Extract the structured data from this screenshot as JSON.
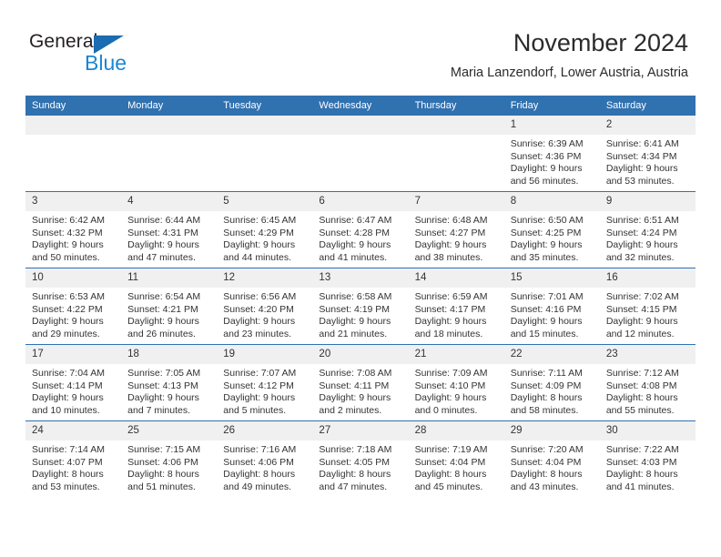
{
  "brand": {
    "name_part1": "General",
    "name_part2": "Blue",
    "logo_icon": "blue-triangle-logo",
    "accent_color": "#1b6cb0",
    "secondary_color": "#1b86d4"
  },
  "header": {
    "month_title": "November 2024",
    "location": "Maria Lanzendorf, Lower Austria, Austria"
  },
  "theme": {
    "header_row_color": "#3071b0",
    "daynum_strip_color": "#f0f0f0",
    "row_divider_color": "#3071b0",
    "text_color": "#333333"
  },
  "calendar": {
    "weekday_headers": [
      "Sunday",
      "Monday",
      "Tuesday",
      "Wednesday",
      "Thursday",
      "Friday",
      "Saturday"
    ],
    "weeks": [
      [
        {
          "day": "",
          "empty": true
        },
        {
          "day": "",
          "empty": true
        },
        {
          "day": "",
          "empty": true
        },
        {
          "day": "",
          "empty": true
        },
        {
          "day": "",
          "empty": true
        },
        {
          "day": "1",
          "sunrise": "Sunrise: 6:39 AM",
          "sunset": "Sunset: 4:36 PM",
          "daylight_line1": "Daylight: 9 hours",
          "daylight_line2": "and 56 minutes."
        },
        {
          "day": "2",
          "sunrise": "Sunrise: 6:41 AM",
          "sunset": "Sunset: 4:34 PM",
          "daylight_line1": "Daylight: 9 hours",
          "daylight_line2": "and 53 minutes."
        }
      ],
      [
        {
          "day": "3",
          "sunrise": "Sunrise: 6:42 AM",
          "sunset": "Sunset: 4:32 PM",
          "daylight_line1": "Daylight: 9 hours",
          "daylight_line2": "and 50 minutes."
        },
        {
          "day": "4",
          "sunrise": "Sunrise: 6:44 AM",
          "sunset": "Sunset: 4:31 PM",
          "daylight_line1": "Daylight: 9 hours",
          "daylight_line2": "and 47 minutes."
        },
        {
          "day": "5",
          "sunrise": "Sunrise: 6:45 AM",
          "sunset": "Sunset: 4:29 PM",
          "daylight_line1": "Daylight: 9 hours",
          "daylight_line2": "and 44 minutes."
        },
        {
          "day": "6",
          "sunrise": "Sunrise: 6:47 AM",
          "sunset": "Sunset: 4:28 PM",
          "daylight_line1": "Daylight: 9 hours",
          "daylight_line2": "and 41 minutes."
        },
        {
          "day": "7",
          "sunrise": "Sunrise: 6:48 AM",
          "sunset": "Sunset: 4:27 PM",
          "daylight_line1": "Daylight: 9 hours",
          "daylight_line2": "and 38 minutes."
        },
        {
          "day": "8",
          "sunrise": "Sunrise: 6:50 AM",
          "sunset": "Sunset: 4:25 PM",
          "daylight_line1": "Daylight: 9 hours",
          "daylight_line2": "and 35 minutes."
        },
        {
          "day": "9",
          "sunrise": "Sunrise: 6:51 AM",
          "sunset": "Sunset: 4:24 PM",
          "daylight_line1": "Daylight: 9 hours",
          "daylight_line2": "and 32 minutes."
        }
      ],
      [
        {
          "day": "10",
          "sunrise": "Sunrise: 6:53 AM",
          "sunset": "Sunset: 4:22 PM",
          "daylight_line1": "Daylight: 9 hours",
          "daylight_line2": "and 29 minutes."
        },
        {
          "day": "11",
          "sunrise": "Sunrise: 6:54 AM",
          "sunset": "Sunset: 4:21 PM",
          "daylight_line1": "Daylight: 9 hours",
          "daylight_line2": "and 26 minutes."
        },
        {
          "day": "12",
          "sunrise": "Sunrise: 6:56 AM",
          "sunset": "Sunset: 4:20 PM",
          "daylight_line1": "Daylight: 9 hours",
          "daylight_line2": "and 23 minutes."
        },
        {
          "day": "13",
          "sunrise": "Sunrise: 6:58 AM",
          "sunset": "Sunset: 4:19 PM",
          "daylight_line1": "Daylight: 9 hours",
          "daylight_line2": "and 21 minutes."
        },
        {
          "day": "14",
          "sunrise": "Sunrise: 6:59 AM",
          "sunset": "Sunset: 4:17 PM",
          "daylight_line1": "Daylight: 9 hours",
          "daylight_line2": "and 18 minutes."
        },
        {
          "day": "15",
          "sunrise": "Sunrise: 7:01 AM",
          "sunset": "Sunset: 4:16 PM",
          "daylight_line1": "Daylight: 9 hours",
          "daylight_line2": "and 15 minutes."
        },
        {
          "day": "16",
          "sunrise": "Sunrise: 7:02 AM",
          "sunset": "Sunset: 4:15 PM",
          "daylight_line1": "Daylight: 9 hours",
          "daylight_line2": "and 12 minutes."
        }
      ],
      [
        {
          "day": "17",
          "sunrise": "Sunrise: 7:04 AM",
          "sunset": "Sunset: 4:14 PM",
          "daylight_line1": "Daylight: 9 hours",
          "daylight_line2": "and 10 minutes."
        },
        {
          "day": "18",
          "sunrise": "Sunrise: 7:05 AM",
          "sunset": "Sunset: 4:13 PM",
          "daylight_line1": "Daylight: 9 hours",
          "daylight_line2": "and 7 minutes."
        },
        {
          "day": "19",
          "sunrise": "Sunrise: 7:07 AM",
          "sunset": "Sunset: 4:12 PM",
          "daylight_line1": "Daylight: 9 hours",
          "daylight_line2": "and 5 minutes."
        },
        {
          "day": "20",
          "sunrise": "Sunrise: 7:08 AM",
          "sunset": "Sunset: 4:11 PM",
          "daylight_line1": "Daylight: 9 hours",
          "daylight_line2": "and 2 minutes."
        },
        {
          "day": "21",
          "sunrise": "Sunrise: 7:09 AM",
          "sunset": "Sunset: 4:10 PM",
          "daylight_line1": "Daylight: 9 hours",
          "daylight_line2": "and 0 minutes."
        },
        {
          "day": "22",
          "sunrise": "Sunrise: 7:11 AM",
          "sunset": "Sunset: 4:09 PM",
          "daylight_line1": "Daylight: 8 hours",
          "daylight_line2": "and 58 minutes."
        },
        {
          "day": "23",
          "sunrise": "Sunrise: 7:12 AM",
          "sunset": "Sunset: 4:08 PM",
          "daylight_line1": "Daylight: 8 hours",
          "daylight_line2": "and 55 minutes."
        }
      ],
      [
        {
          "day": "24",
          "sunrise": "Sunrise: 7:14 AM",
          "sunset": "Sunset: 4:07 PM",
          "daylight_line1": "Daylight: 8 hours",
          "daylight_line2": "and 53 minutes."
        },
        {
          "day": "25",
          "sunrise": "Sunrise: 7:15 AM",
          "sunset": "Sunset: 4:06 PM",
          "daylight_line1": "Daylight: 8 hours",
          "daylight_line2": "and 51 minutes."
        },
        {
          "day": "26",
          "sunrise": "Sunrise: 7:16 AM",
          "sunset": "Sunset: 4:06 PM",
          "daylight_line1": "Daylight: 8 hours",
          "daylight_line2": "and 49 minutes."
        },
        {
          "day": "27",
          "sunrise": "Sunrise: 7:18 AM",
          "sunset": "Sunset: 4:05 PM",
          "daylight_line1": "Daylight: 8 hours",
          "daylight_line2": "and 47 minutes."
        },
        {
          "day": "28",
          "sunrise": "Sunrise: 7:19 AM",
          "sunset": "Sunset: 4:04 PM",
          "daylight_line1": "Daylight: 8 hours",
          "daylight_line2": "and 45 minutes."
        },
        {
          "day": "29",
          "sunrise": "Sunrise: 7:20 AM",
          "sunset": "Sunset: 4:04 PM",
          "daylight_line1": "Daylight: 8 hours",
          "daylight_line2": "and 43 minutes."
        },
        {
          "day": "30",
          "sunrise": "Sunrise: 7:22 AM",
          "sunset": "Sunset: 4:03 PM",
          "daylight_line1": "Daylight: 8 hours",
          "daylight_line2": "and 41 minutes."
        }
      ]
    ]
  }
}
